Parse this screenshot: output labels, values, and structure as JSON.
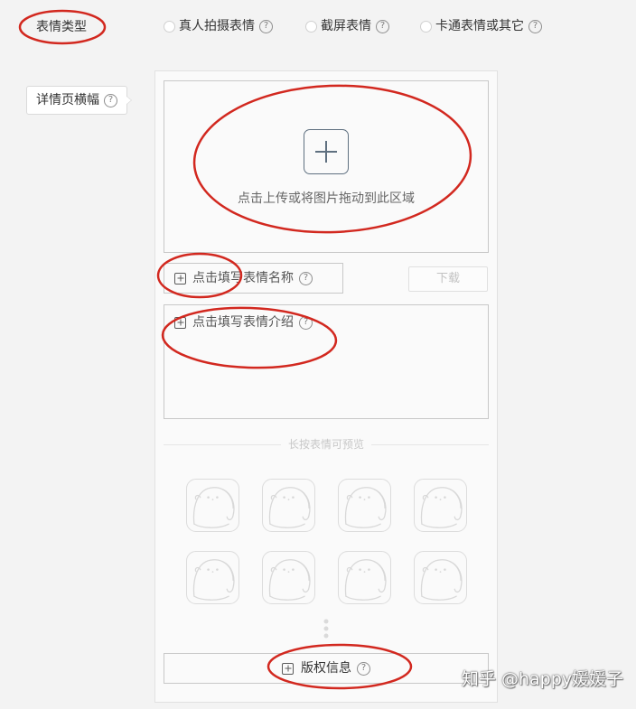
{
  "form": {
    "sticker_type": {
      "label": "表情类型",
      "options": [
        {
          "label": "真人拍摄表情",
          "selected": false
        },
        {
          "label": "截屏表情",
          "selected": false
        },
        {
          "label": "卡通表情或其它",
          "selected": false
        }
      ]
    },
    "banner": {
      "label": "详情页横幅"
    }
  },
  "editor": {
    "upload": {
      "hint": "点击上传或将图片拖动到此区域",
      "icon": "plus-icon"
    },
    "name_field": {
      "text": "点击填写表情名称",
      "icon": "plus-square-icon"
    },
    "download_button": {
      "label": "下载",
      "disabled": true
    },
    "intro_field": {
      "text": "点击填写表情介绍",
      "icon": "plus-square-icon"
    },
    "preview": {
      "divider_label": "长按表情可预览",
      "slots": [
        "sticker-placeholder-icon",
        "sticker-placeholder-icon",
        "sticker-placeholder-icon",
        "sticker-placeholder-icon",
        "sticker-placeholder-icon",
        "sticker-placeholder-icon",
        "sticker-placeholder-icon",
        "sticker-placeholder-icon"
      ],
      "more_icon": "vertical-ellipsis-icon"
    },
    "copyright": {
      "label": "版权信息",
      "icon": "plus-square-icon"
    }
  },
  "icons": {
    "help": "help-circle-icon",
    "help_glyph": "?",
    "radio": "radio-empty-icon"
  },
  "watermark": {
    "text": "知乎 @happy媛媛子"
  },
  "colors": {
    "page_bg": "#f3f3f3",
    "panel_bg": "#fafafa",
    "border": "#c8c8c8",
    "text": "#333333",
    "muted_text": "#555555",
    "disabled_text": "#c2c2c2",
    "icon_stroke": "#5f7080",
    "placeholder_stroke": "#d8d8d8",
    "annotation": "#d2281f",
    "watermark_text": "#ffffff"
  }
}
